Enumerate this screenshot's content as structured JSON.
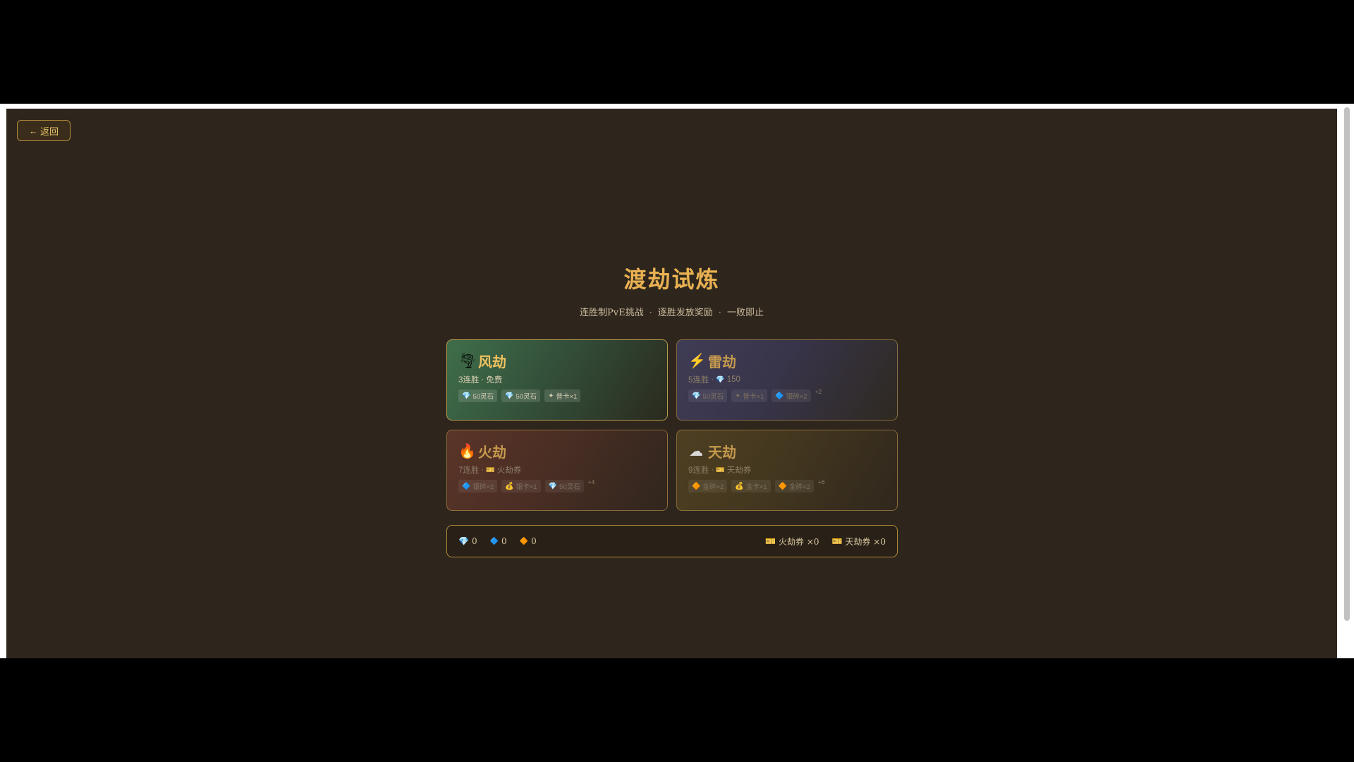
{
  "back_button": {
    "arrow": "←",
    "label": "返回"
  },
  "title": "渡劫试炼",
  "subtitle": {
    "part1": "连胜制PvE挑战",
    "part2": "逐胜发放奖励",
    "part3": "一败即止",
    "separator": "·"
  },
  "cards": {
    "wind": {
      "icon": "🌪",
      "name": "风劫",
      "wins": "3连胜",
      "sep": "·",
      "cost_icon": "",
      "cost": "免费",
      "rewards": [
        {
          "icon": "💎",
          "label": "50灵石"
        },
        {
          "icon": "💎",
          "label": "50灵石"
        },
        {
          "icon": "✦",
          "label": "普卡×1"
        }
      ],
      "more": ""
    },
    "thunder": {
      "icon": "⚡",
      "name": "雷劫",
      "wins": "5连胜",
      "sep": "·",
      "cost_icon": "💎",
      "cost": "150",
      "rewards": [
        {
          "icon": "💎",
          "label": "50灵石"
        },
        {
          "icon": "✦",
          "label": "普卡×1"
        },
        {
          "icon": "🔷",
          "label": "银碎×2"
        }
      ],
      "more": "+2"
    },
    "fire": {
      "icon": "🔥",
      "name": "火劫",
      "wins": "7连胜",
      "sep": "·",
      "cost_icon": "🎫",
      "cost": "火劫券",
      "rewards": [
        {
          "icon": "🔷",
          "label": "银碎×2"
        },
        {
          "icon": "💰",
          "label": "银卡×1"
        },
        {
          "icon": "💎",
          "label": "50灵石"
        }
      ],
      "more": "+4"
    },
    "heaven": {
      "icon": "☁",
      "name": "天劫",
      "wins": "9连胜",
      "sep": "·",
      "cost_icon": "🎫",
      "cost": "天劫券",
      "rewards": [
        {
          "icon": "🔶",
          "label": "金碎×2"
        },
        {
          "icon": "💰",
          "label": "金卡×1"
        },
        {
          "icon": "🔶",
          "label": "金碎×2"
        }
      ],
      "more": "+6"
    }
  },
  "resources": {
    "spirit_stone": {
      "icon": "💎",
      "value": "0"
    },
    "silver_shard": {
      "icon": "🔷",
      "value": "0"
    },
    "gold_shard": {
      "icon": "🔶",
      "value": "0"
    },
    "fire_ticket": {
      "icon": "🎫",
      "label": "火劫券 ×0"
    },
    "heaven_ticket": {
      "icon": "🎫",
      "label": "天劫券 ×0"
    }
  },
  "colors": {
    "background": "#2e261d",
    "accent_gold": "#e9b152",
    "border_gold": "#b48a3a"
  }
}
